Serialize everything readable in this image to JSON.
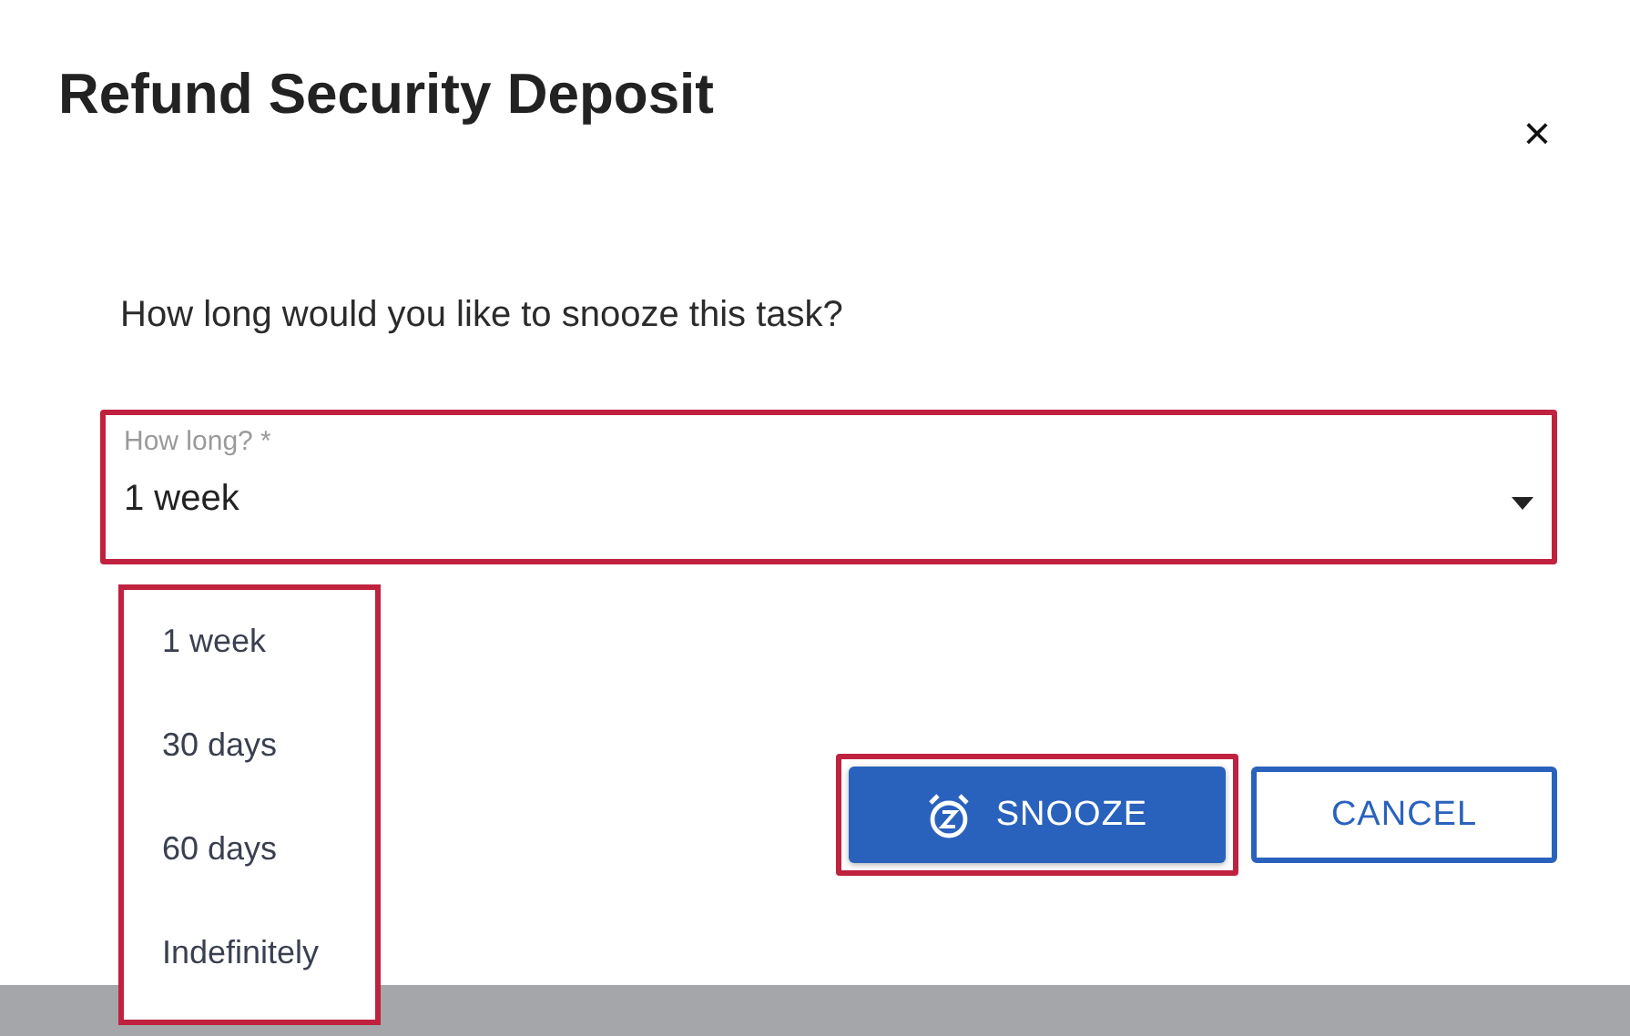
{
  "dialog": {
    "title": "Refund Security Deposit",
    "close": "×",
    "question": "How long would you like to snooze this task?"
  },
  "field": {
    "label": "How long? *",
    "value": "1 week"
  },
  "menu": {
    "options": [
      {
        "label": "1 week"
      },
      {
        "label": "30 days"
      },
      {
        "label": "60 days"
      },
      {
        "label": "Indefinitely"
      }
    ]
  },
  "buttons": [
    {
      "kind": "primary",
      "label": "SNOOZE"
    },
    {
      "kind": "secondary",
      "label": "CANCEL"
    }
  ]
}
